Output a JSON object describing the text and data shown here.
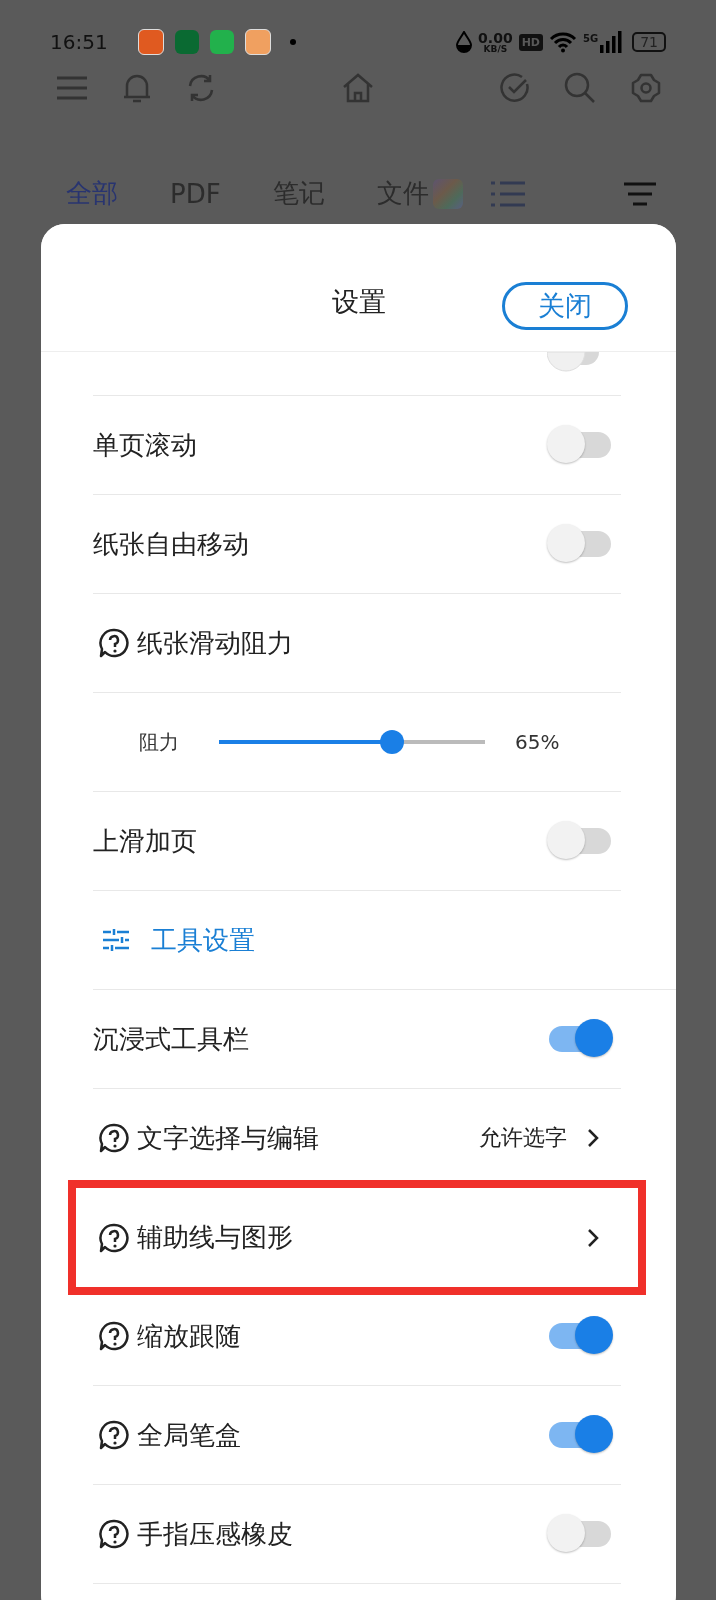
{
  "status_bar": {
    "time": "16:51",
    "speed": "0.00",
    "speed_unit": "KB/S",
    "hd": "HD",
    "network": "5G",
    "battery": "71"
  },
  "tabs": [
    {
      "label": "全部",
      "selected": true
    },
    {
      "label": "PDF",
      "selected": false
    },
    {
      "label": "笔记",
      "selected": false
    },
    {
      "label": "文件",
      "selected": false
    }
  ],
  "sheet": {
    "title": "设置",
    "close_button": "关闭",
    "items": [
      {
        "kind": "toggle-cut",
        "on": false
      },
      {
        "kind": "toggle",
        "label": "单页滚动",
        "help": false,
        "on": false
      },
      {
        "kind": "toggle",
        "label": "纸张自由移动",
        "help": false,
        "on": false
      },
      {
        "kind": "heading",
        "label": "纸张滑动阻力",
        "help": true
      },
      {
        "kind": "slider",
        "label": "阻力",
        "level": 0.65,
        "reading": "65%"
      },
      {
        "kind": "toggle",
        "label": "上滑加页",
        "help": false,
        "on": false
      },
      {
        "kind": "section",
        "label": "工具设置"
      },
      {
        "kind": "toggle",
        "label": "沉浸式工具栏",
        "help": false,
        "on": true
      },
      {
        "kind": "nav",
        "label": "文字选择与编辑",
        "help": true,
        "value": "允许选字",
        "highlighted": false
      },
      {
        "kind": "nav",
        "label": "辅助线与图形",
        "help": true,
        "highlighted": true
      },
      {
        "kind": "toggle",
        "label": "缩放跟随",
        "help": true,
        "on": true
      },
      {
        "kind": "toggle",
        "label": "全局笔盒",
        "help": true,
        "on": true
      },
      {
        "kind": "toggle",
        "label": "手指压感橡皮",
        "help": true,
        "on": false
      }
    ]
  }
}
